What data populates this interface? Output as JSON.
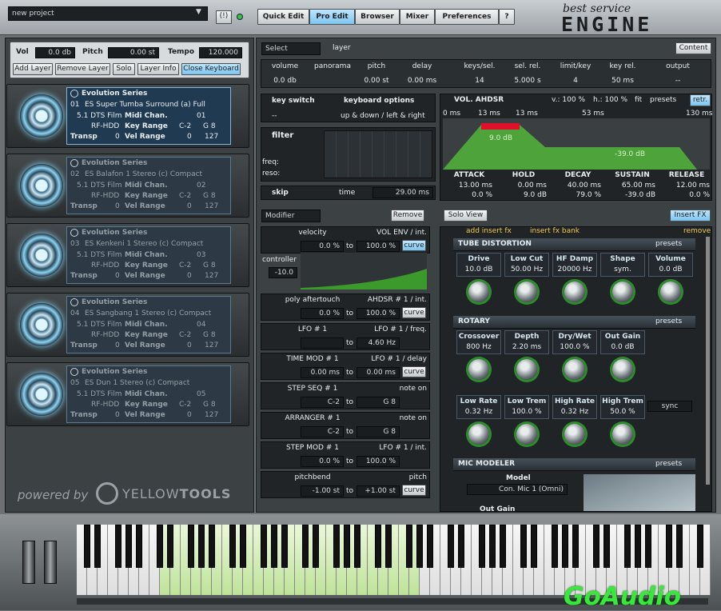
{
  "header": {
    "project": "new project",
    "brand_top": "best service",
    "brand_main": "ENGINE",
    "tabs": [
      "Quick Edit",
      "Pro Edit",
      "Browser",
      "Mixer",
      "Preferences",
      "?"
    ],
    "active_tab": "Pro Edit"
  },
  "left": {
    "vol_label": "Vol",
    "vol_value": "0.0 db",
    "pitch_label": "Pitch",
    "pitch_value": "0.00 st",
    "tempo_label": "Tempo",
    "tempo_value": "120.000",
    "buttons": [
      "Add Layer",
      "Remove Layer",
      "Solo",
      "Layer Info",
      "Close Keyboard"
    ],
    "slots": [
      {
        "series": "Evolution Series",
        "num": "01",
        "name": "ES Super Tumba Surround (a) Full",
        "out": "5.1 DTS Film",
        "midi_label": "Midi Chan.",
        "midi": "01",
        "hdd": "RF-HDD",
        "keyrange_label": "Key Range",
        "key_lo": "C-2",
        "key_hi": "G 8",
        "transp_label": "Transp",
        "transp": "0",
        "velrange_label": "Vel Range",
        "vel_lo": "0",
        "vel_hi": "127"
      },
      {
        "series": "Evolution Series",
        "num": "02",
        "name": "ES Balafon 1 Stereo (c) Compact",
        "out": "5.1 DTS Film",
        "midi_label": "Midi Chan.",
        "midi": "02",
        "hdd": "RF-HDD",
        "keyrange_label": "Key Range",
        "key_lo": "C-2",
        "key_hi": "G 8",
        "transp_label": "Transp",
        "transp": "0",
        "velrange_label": "Vel Range",
        "vel_lo": "0",
        "vel_hi": "127"
      },
      {
        "series": "Evolution Series",
        "num": "03",
        "name": "ES Kenkeni 1 Stereo (c) Compact",
        "out": "5.1 DTS Film",
        "midi_label": "Midi Chan.",
        "midi": "03",
        "hdd": "RF-HDD",
        "keyrange_label": "Key Range",
        "key_lo": "C-2",
        "key_hi": "G 8",
        "transp_label": "Transp",
        "transp": "0",
        "velrange_label": "Vel Range",
        "vel_lo": "0",
        "vel_hi": "127"
      },
      {
        "series": "Evolution Series",
        "num": "04",
        "name": "ES Sangbang 1 Stereo (c) Compact",
        "out": "5.1 DTS Film",
        "midi_label": "Midi Chan.",
        "midi": "04",
        "hdd": "RF-HDD",
        "keyrange_label": "Key Range",
        "key_lo": "C-2",
        "key_hi": "G 8",
        "transp_label": "Transp",
        "transp": "0",
        "velrange_label": "Vel Range",
        "vel_lo": "0",
        "vel_hi": "127"
      },
      {
        "series": "Evolution Series",
        "num": "05",
        "name": "ES Dun 1 Stereo (c) Compact",
        "out": "5.1 DTS Film",
        "midi_label": "Midi Chan.",
        "midi": "05",
        "hdd": "RF-HDD",
        "keyrange_label": "Key Range",
        "key_lo": "C-2",
        "key_hi": "G 8",
        "transp_label": "Transp",
        "transp": "0",
        "velrange_label": "Vel Range",
        "vel_lo": "0",
        "vel_hi": "127"
      }
    ],
    "powered": "powered by",
    "yellow": "YELLOW",
    "tools": "TOOLS"
  },
  "layer": {
    "select": "Select",
    "label": "layer",
    "content": "Content",
    "cols": [
      "volume",
      "panorama",
      "pitch",
      "delay",
      "keys/sel.",
      "sel. rel.",
      "limit/key",
      "key rel.",
      "output"
    ],
    "vals": [
      "0.0 db",
      "",
      "0.00 st",
      "0.00 ms",
      "14",
      "5.000 s",
      "4",
      "50 ms",
      "--"
    ]
  },
  "keyswitch": {
    "label": "key switch",
    "value": "--",
    "kb_label": "keyboard options",
    "kb_value": "up & down / left & right"
  },
  "filter": {
    "label": "filter",
    "freq": "freq:",
    "reso": "reso:"
  },
  "skip": {
    "label": "skip",
    "time": "time",
    "value": "29.00 ms"
  },
  "ahdsr": {
    "title": "VOL. AHDSR",
    "v_label": "v.:",
    "v": "100 %",
    "h_label": "h.:",
    "h": "100 %",
    "fit": "fit",
    "presets": "presets",
    "retr": "retr.",
    "ruler": [
      "0 ms",
      "13 ms",
      "13 ms",
      "53 ms",
      "130 ms"
    ],
    "hold_lbl": "9.0 dB",
    "sus_lbl": "-39.0 dB",
    "cols": [
      "ATTACK",
      "HOLD",
      "DECAY",
      "SUSTAIN",
      "RELEASE"
    ],
    "t": [
      "13.00 ms",
      "0.00 ms",
      "40.00 ms",
      "65.00 ms",
      "12.00 ms"
    ],
    "c": [
      "0.0 %",
      "9.0 dB",
      "79.0 %",
      "-39.0 dB",
      "0.0 %"
    ]
  },
  "modifier": {
    "select": "Modifier",
    "remove": "Remove",
    "solo": "Solo View",
    "insert": "Insert FX",
    "rows": [
      {
        "src": "velocity",
        "dst": "VOL ENV / int.",
        "from": "0.0 %",
        "to": "100.0 %",
        "mode": "curve"
      },
      {
        "src": "poly aftertouch",
        "dst": "AHDSR # 1 / int.",
        "from": "0.0 %",
        "to": "100.0 %",
        "mode": "curve"
      },
      {
        "src": "LFO # 1",
        "dst": "LFO # 1 / freq.",
        "from": "",
        "to": "4.60 Hz",
        "mode": ""
      },
      {
        "src": "TIME MOD # 1",
        "dst": "LFO # 1 / delay",
        "from": "0.00 ms",
        "to": "0.00 ms",
        "mode": "curve"
      },
      {
        "src": "STEP SEQ # 1",
        "dst": "note on",
        "from": "C-2",
        "to": "G 8",
        "mode": ""
      },
      {
        "src": "ARRANGER # 1",
        "dst": "note on",
        "from": "C-2",
        "to": "G 8",
        "mode": ""
      },
      {
        "src": "STEP MOD # 1",
        "dst": "LFO # 1 / int.",
        "from": "0.0 %",
        "to": "100.0 %",
        "mode": ""
      },
      {
        "src": "pitchbend",
        "dst": "pitch",
        "from": "-1.00 st",
        "to": "+1.00 st",
        "mode": "curve"
      }
    ],
    "controller": "controller",
    "ctrl_val": "-10.0",
    "to": "to"
  },
  "fx": {
    "add": "add insert fx",
    "bank": "insert fx bank",
    "remove": "remove",
    "tube": {
      "title": "TUBE DISTORTION",
      "presets": "presets",
      "params": [
        [
          "Drive",
          "10.0 dB"
        ],
        [
          "Low Cut",
          "50.00 Hz"
        ],
        [
          "HF Damp",
          "20000 Hz"
        ],
        [
          "Shape",
          "sym."
        ],
        [
          "Volume",
          "0.0 dB"
        ]
      ]
    },
    "rotary": {
      "title": "ROTARY",
      "presets": "presets",
      "params": [
        [
          "Crossover",
          "800 Hz"
        ],
        [
          "Depth",
          "2.20 ms"
        ],
        [
          "Dry/Wet",
          "100.0 %"
        ],
        [
          "Out Gain",
          "0.0 dB"
        ]
      ],
      "params2": [
        [
          "Low Rate",
          "0.32 Hz"
        ],
        [
          "Low Trem",
          "100.0 %"
        ],
        [
          "High Rate",
          "0.32 Hz"
        ],
        [
          "High Trem",
          "50.0 %"
        ]
      ],
      "sync": "sync"
    },
    "mic": {
      "title": "MIC MODELER",
      "presets": "presets",
      "model_label": "Model",
      "model": "Con. Mic 1 (Omni)",
      "out": "Out Gain"
    }
  },
  "colors": {
    "green": "#3c9a2c",
    "accent": "#7cc4ef",
    "red": "#e0102a"
  },
  "watermark": "GoAudio"
}
